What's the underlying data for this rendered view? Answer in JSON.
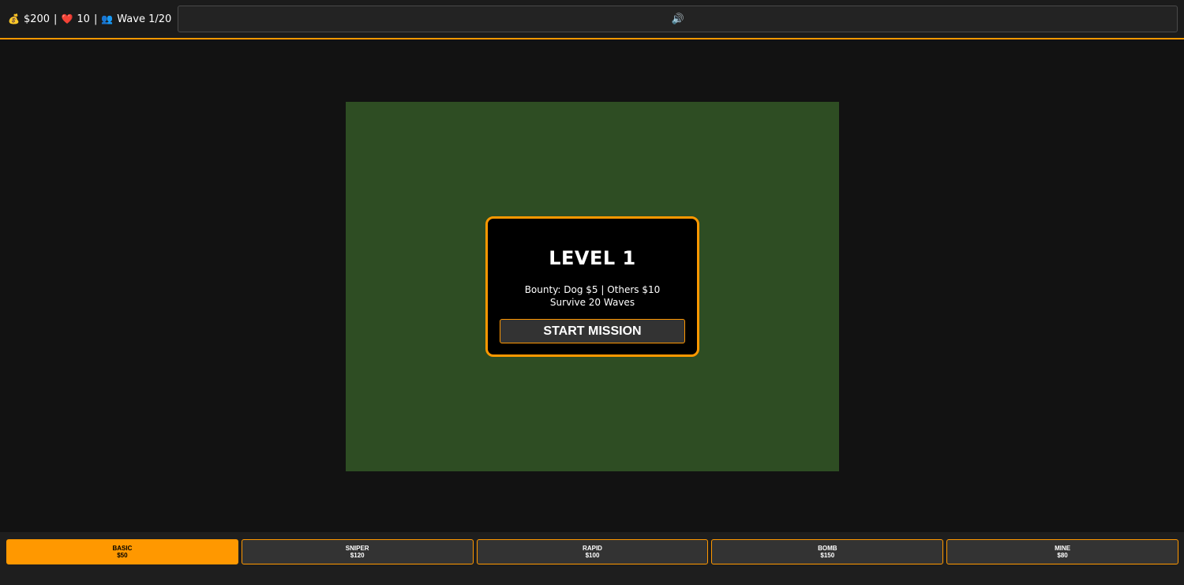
{
  "hud": {
    "money_icon": "💰",
    "money": "$200",
    "lives_icon": "❤️",
    "lives": "10",
    "wave_icon": "👥",
    "wave": "Wave 1/20",
    "separator": "|",
    "sound_icon": "🔊"
  },
  "modal": {
    "title": "LEVEL 1",
    "bounty": "Bounty: Dog $5 | Others $10",
    "goal": "Survive 20 Waves",
    "start_label": "START MISSION"
  },
  "towers": [
    {
      "name": "BASIC",
      "cost": "$50",
      "selected": true
    },
    {
      "name": "SNIPER",
      "cost": "$120",
      "selected": false
    },
    {
      "name": "RAPID",
      "cost": "$100",
      "selected": false
    },
    {
      "name": "BOMB",
      "cost": "$150",
      "selected": false
    },
    {
      "name": "MINE",
      "cost": "$80",
      "selected": false
    }
  ],
  "colors": {
    "accent": "#ff9800",
    "field": "#2e4d23",
    "background": "#121212"
  }
}
